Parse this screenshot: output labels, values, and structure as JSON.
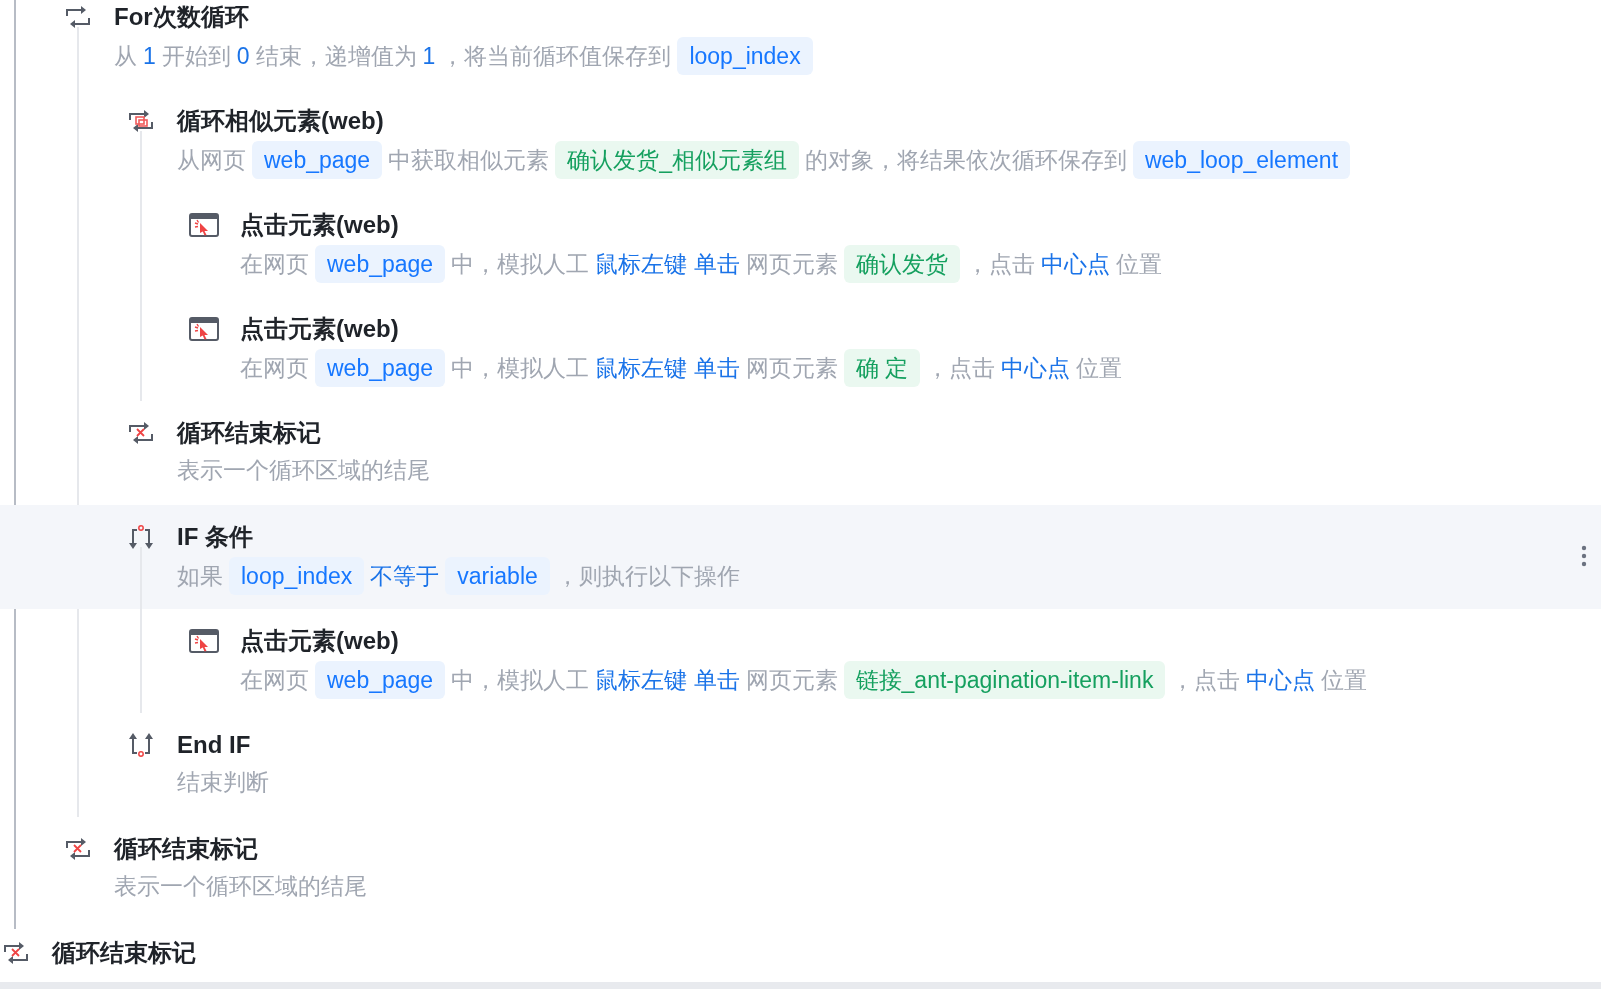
{
  "steps": [
    {
      "kind": "for_loop",
      "title": "For次数循环",
      "highlighted": false,
      "description": [
        {
          "kind": "text",
          "text": "从"
        },
        {
          "kind": "value",
          "text": "1"
        },
        {
          "kind": "text",
          "text": "开始到"
        },
        {
          "kind": "value",
          "text": "0"
        },
        {
          "kind": "text",
          "text": "结束，递增值为"
        },
        {
          "kind": "value",
          "text": "1"
        },
        {
          "kind": "text",
          "text": "，将当前循环值保存到"
        },
        {
          "kind": "variable",
          "text": "loop_index"
        }
      ],
      "children": [
        {
          "kind": "loop_elements",
          "title": "循环相似元素(web)",
          "highlighted": false,
          "description": [
            {
              "kind": "text",
              "text": "从网页"
            },
            {
              "kind": "variable",
              "text": "web_page"
            },
            {
              "kind": "text",
              "text": "中获取相似元素"
            },
            {
              "kind": "element",
              "text": "确认发货_相似元素组"
            },
            {
              "kind": "text",
              "text": "的对象，将结果依次循环保存到"
            },
            {
              "kind": "variable",
              "text": "web_loop_element"
            }
          ],
          "children": [
            {
              "kind": "click",
              "title": "点击元素(web)",
              "highlighted": false,
              "description": [
                {
                  "kind": "text",
                  "text": "在网页"
                },
                {
                  "kind": "variable",
                  "text": "web_page"
                },
                {
                  "kind": "text",
                  "text": "中，模拟人工"
                },
                {
                  "kind": "value",
                  "text": "鼠标左键 单击"
                },
                {
                  "kind": "text",
                  "text": "网页元素"
                },
                {
                  "kind": "element",
                  "text": "确认发货"
                },
                {
                  "kind": "text",
                  "text": "，点击"
                },
                {
                  "kind": "value",
                  "text": "中心点"
                },
                {
                  "kind": "text",
                  "text": "位置"
                }
              ]
            },
            {
              "kind": "click",
              "title": "点击元素(web)",
              "highlighted": false,
              "description": [
                {
                  "kind": "text",
                  "text": "在网页"
                },
                {
                  "kind": "variable",
                  "text": "web_page"
                },
                {
                  "kind": "text",
                  "text": "中，模拟人工"
                },
                {
                  "kind": "value",
                  "text": "鼠标左键 单击"
                },
                {
                  "kind": "text",
                  "text": "网页元素"
                },
                {
                  "kind": "element",
                  "text": "确 定"
                },
                {
                  "kind": "text",
                  "text": "，点击"
                },
                {
                  "kind": "value",
                  "text": "中心点"
                },
                {
                  "kind": "text",
                  "text": "位置"
                }
              ]
            }
          ]
        },
        {
          "kind": "loop_end",
          "title": "循环结束标记",
          "highlighted": false,
          "description": [
            {
              "kind": "text",
              "text": "表示一个循环区域的结尾"
            }
          ]
        },
        {
          "kind": "if",
          "title": "IF 条件",
          "highlighted": true,
          "description": [
            {
              "kind": "text",
              "text": "如果"
            },
            {
              "kind": "variable",
              "text": "loop_index"
            },
            {
              "kind": "value",
              "text": "不等于"
            },
            {
              "kind": "variable",
              "text": "variable"
            },
            {
              "kind": "text",
              "text": "，则执行以下操作"
            }
          ],
          "children": [
            {
              "kind": "click",
              "title": "点击元素(web)",
              "highlighted": false,
              "description": [
                {
                  "kind": "text",
                  "text": "在网页"
                },
                {
                  "kind": "variable",
                  "text": "web_page"
                },
                {
                  "kind": "text",
                  "text": "中，模拟人工"
                },
                {
                  "kind": "value",
                  "text": "鼠标左键 单击"
                },
                {
                  "kind": "text",
                  "text": "网页元素"
                },
                {
                  "kind": "element",
                  "text": "链接_ant-pagination-item-link"
                },
                {
                  "kind": "text",
                  "text": "，点击"
                },
                {
                  "kind": "value",
                  "text": "中心点"
                },
                {
                  "kind": "text",
                  "text": "位置"
                }
              ]
            }
          ]
        },
        {
          "kind": "end_if",
          "title": "End IF",
          "highlighted": false,
          "description": [
            {
              "kind": "text",
              "text": "结束判断"
            }
          ]
        }
      ]
    },
    {
      "kind": "loop_end",
      "title": "循环结束标记",
      "highlighted": false,
      "description": [
        {
          "kind": "text",
          "text": "表示一个循环区域的结尾"
        }
      ]
    }
  ],
  "trailing_steps": [
    {
      "kind": "loop_end",
      "title": "循环结束标记",
      "highlighted": false
    }
  ]
}
